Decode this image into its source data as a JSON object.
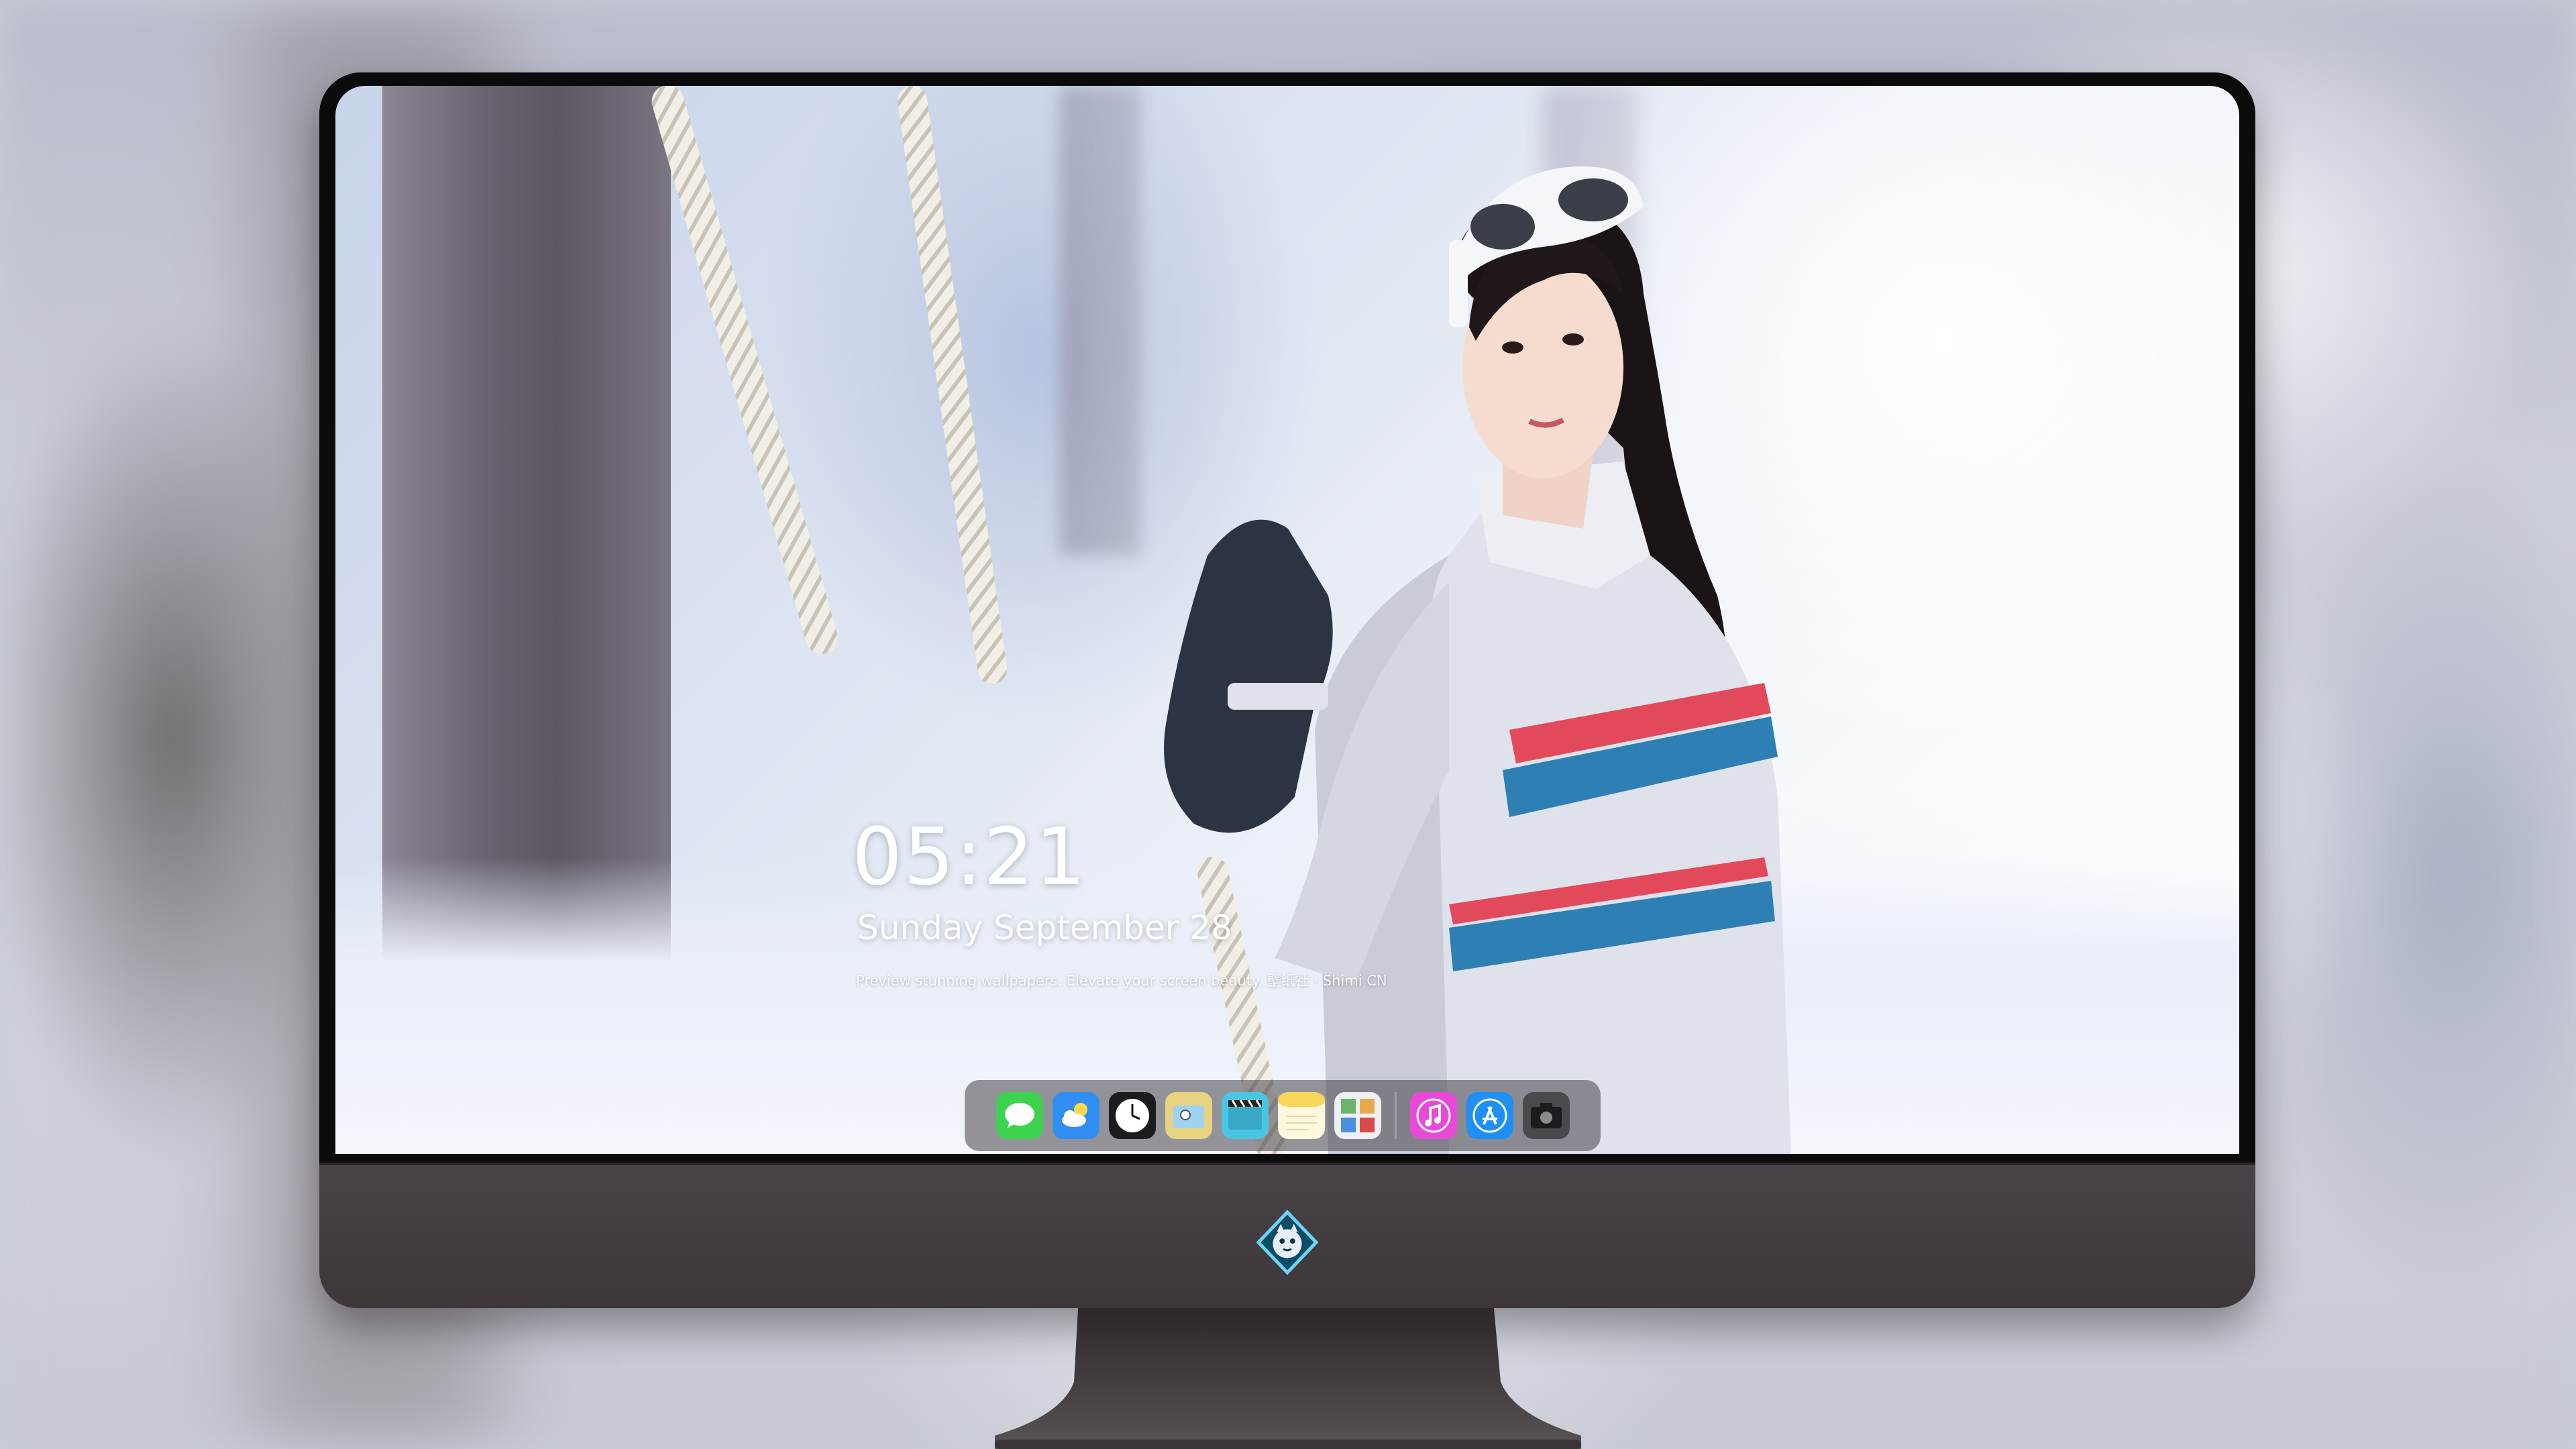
{
  "lockscreen": {
    "time": "05:21",
    "date": "Sunday September  28",
    "tagline": "Preview stunning wallpapers. Elevate your screen beauty. 壁纸社 · Shimi CN"
  },
  "dock": {
    "apps": [
      {
        "name": "messages-icon",
        "color": "#3dd34f"
      },
      {
        "name": "weather-icon",
        "color": "#2f8ef0"
      },
      {
        "name": "clock-icon",
        "color": "#1c1c1e"
      },
      {
        "name": "preview-icon",
        "color": "#e8d480"
      },
      {
        "name": "clapper-icon",
        "color": "#49c6e4"
      },
      {
        "name": "notes-icon",
        "color": "#f7d65a"
      },
      {
        "name": "photos-icon",
        "color": "#6ab56a"
      },
      {
        "name": "music-icon",
        "color": "#e84ad8"
      },
      {
        "name": "app-store-icon",
        "color": "#1e8ff5"
      },
      {
        "name": "camera-icon",
        "color": "#4a4a4c"
      }
    ]
  },
  "colors": {
    "bezel": "#0b0b0c",
    "chin": "#3d373a",
    "accent_blue": "#2e7fb4",
    "accent_red": "#e24a5b"
  }
}
